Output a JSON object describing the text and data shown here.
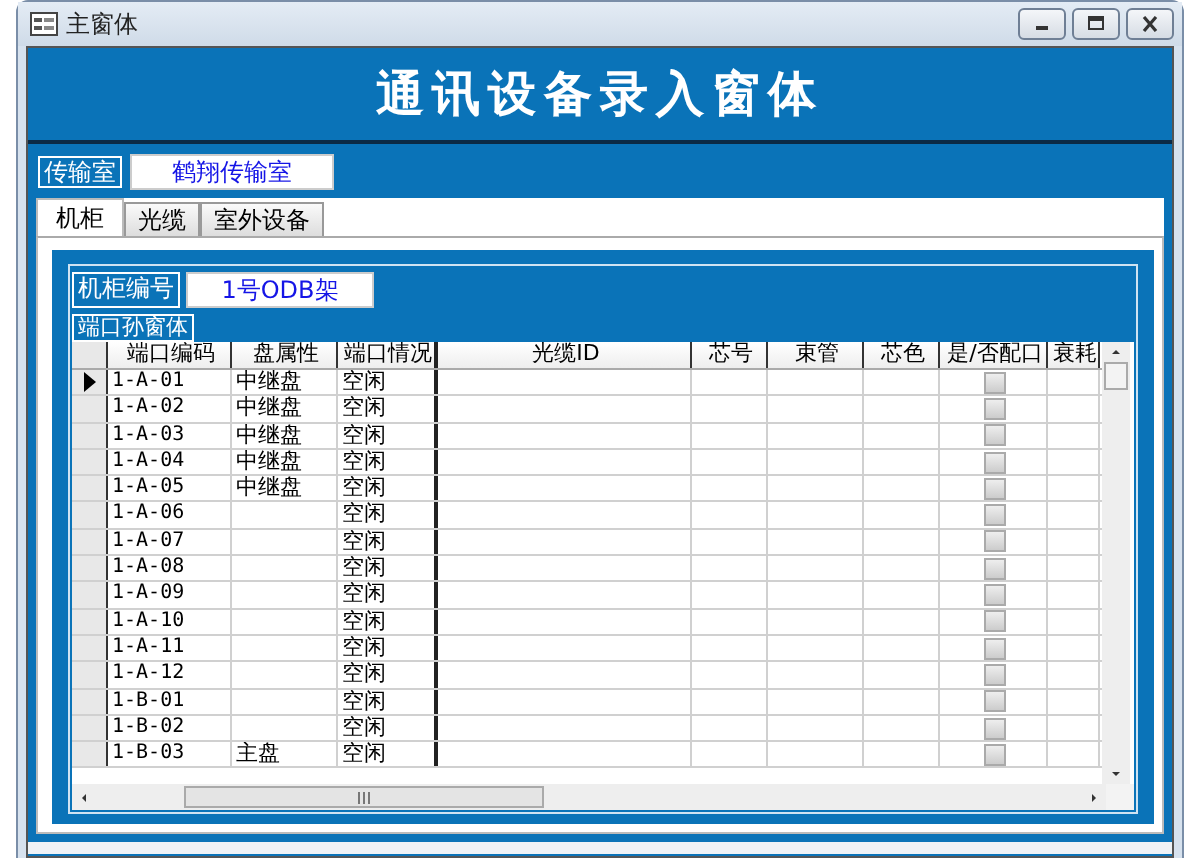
{
  "window": {
    "title": "主窗体"
  },
  "header": {
    "title": "通讯设备录入窗体"
  },
  "room": {
    "label": "传输室",
    "value": "鹤翔传输室"
  },
  "tabs": [
    {
      "label": "机柜",
      "selected": true
    },
    {
      "label": "光缆",
      "selected": false
    },
    {
      "label": "室外设备",
      "selected": false
    }
  ],
  "cabinet": {
    "label": "机柜编号",
    "value": "1号ODB架"
  },
  "subform": {
    "label": "端口孙窗体"
  },
  "table": {
    "columns": [
      "端口编码",
      "盘属性",
      "端口情况",
      "光缆ID",
      "芯号",
      "束管",
      "芯色",
      "是/否配口",
      "衰耗"
    ],
    "rows": [
      {
        "code": "1-A-01",
        "disk": "中继盘",
        "status": "空闲",
        "matched": false,
        "selected": true
      },
      {
        "code": "1-A-02",
        "disk": "中继盘",
        "status": "空闲",
        "matched": false,
        "selected": false
      },
      {
        "code": "1-A-03",
        "disk": "中继盘",
        "status": "空闲",
        "matched": false,
        "selected": false
      },
      {
        "code": "1-A-04",
        "disk": "中继盘",
        "status": "空闲",
        "matched": false,
        "selected": false
      },
      {
        "code": "1-A-05",
        "disk": "中继盘",
        "status": "空闲",
        "matched": false,
        "selected": false
      },
      {
        "code": "1-A-06",
        "status": "空闲",
        "matched": false,
        "selected": false
      },
      {
        "code": "1-A-07",
        "status": "空闲",
        "matched": false,
        "selected": false
      },
      {
        "code": "1-A-08",
        "status": "空闲",
        "matched": false,
        "selected": false
      },
      {
        "code": "1-A-09",
        "status": "空闲",
        "matched": false,
        "selected": false
      },
      {
        "code": "1-A-10",
        "status": "空闲",
        "matched": false,
        "selected": false
      },
      {
        "code": "1-A-11",
        "status": "空闲",
        "matched": false,
        "selected": false
      },
      {
        "code": "1-A-12",
        "status": "空闲",
        "matched": false,
        "selected": false
      },
      {
        "code": "1-B-01",
        "status": "空闲",
        "matched": false,
        "selected": false
      },
      {
        "code": "1-B-02",
        "status": "空闲",
        "matched": false,
        "selected": false
      },
      {
        "code": "1-B-03",
        "disk": "主盘",
        "status": "空闲",
        "matched": false,
        "selected": false
      }
    ]
  }
}
